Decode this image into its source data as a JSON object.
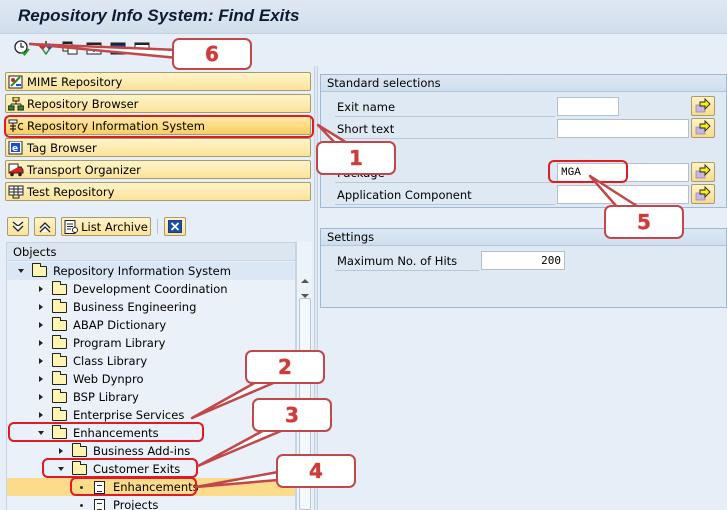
{
  "window": {
    "title": "Repository Info System: Find Exits"
  },
  "toolbar": {
    "icons": [
      "execute-clock-icon",
      "hierarchy-icon",
      "copy-window-icon",
      "insert-icon",
      "display-icon",
      "table-icon"
    ]
  },
  "navigation": {
    "buttons": [
      {
        "label": "MIME Repository",
        "icon": "mime-repository-icon"
      },
      {
        "label": "Repository Browser",
        "icon": "repository-browser-icon"
      },
      {
        "label": "Repository Information System",
        "icon": "repository-info-system-icon",
        "active": true
      },
      {
        "label": "Tag Browser",
        "icon": "tag-browser-icon"
      },
      {
        "label": "Transport Organizer",
        "icon": "transport-truck-icon"
      },
      {
        "label": "Test Repository",
        "icon": "test-repository-icon"
      }
    ]
  },
  "tree_toolbar": {
    "expand_label": "",
    "collapse_label": "",
    "list_archive_label": "List Archive",
    "close_label": ""
  },
  "tree": {
    "header": "Objects",
    "items": [
      {
        "label": "Repository Information System",
        "level": 0,
        "state": "expanded",
        "type": "folder"
      },
      {
        "label": "Development Coordination",
        "level": 1,
        "state": "collapsed",
        "type": "folder"
      },
      {
        "label": "Business Engineering",
        "level": 1,
        "state": "collapsed",
        "type": "folder"
      },
      {
        "label": "ABAP Dictionary",
        "level": 1,
        "state": "collapsed",
        "type": "folder"
      },
      {
        "label": "Program Library",
        "level": 1,
        "state": "collapsed",
        "type": "folder"
      },
      {
        "label": "Class Library",
        "level": 1,
        "state": "collapsed",
        "type": "folder"
      },
      {
        "label": "Web Dynpro",
        "level": 1,
        "state": "collapsed",
        "type": "folder"
      },
      {
        "label": "BSP Library",
        "level": 1,
        "state": "collapsed",
        "type": "folder"
      },
      {
        "label": "Enterprise Services",
        "level": 1,
        "state": "collapsed",
        "type": "folder"
      },
      {
        "label": "Enhancements",
        "level": 1,
        "state": "expanded",
        "type": "folder"
      },
      {
        "label": "Business Add-ins",
        "level": 2,
        "state": "collapsed",
        "type": "folder"
      },
      {
        "label": "Customer Exits",
        "level": 2,
        "state": "expanded",
        "type": "folder"
      },
      {
        "label": "Enhancements",
        "level": 3,
        "state": "leaf",
        "type": "document",
        "selected": true
      },
      {
        "label": "Projects",
        "level": 3,
        "state": "leaf",
        "type": "document"
      }
    ]
  },
  "standard_selections": {
    "title": "Standard selections",
    "fields": [
      {
        "label": "Exit name",
        "value": ""
      },
      {
        "label": "Short text",
        "value": ""
      },
      {
        "label": "Package",
        "value": "MGA"
      },
      {
        "label": "Application Component",
        "value": ""
      }
    ]
  },
  "settings": {
    "title": "Settings",
    "max_hits_label": "Maximum No. of Hits",
    "max_hits_value": "200"
  },
  "annotations": {
    "callouts": [
      "1",
      "2",
      "3",
      "4",
      "5",
      "6"
    ],
    "color": "#c0484a"
  }
}
